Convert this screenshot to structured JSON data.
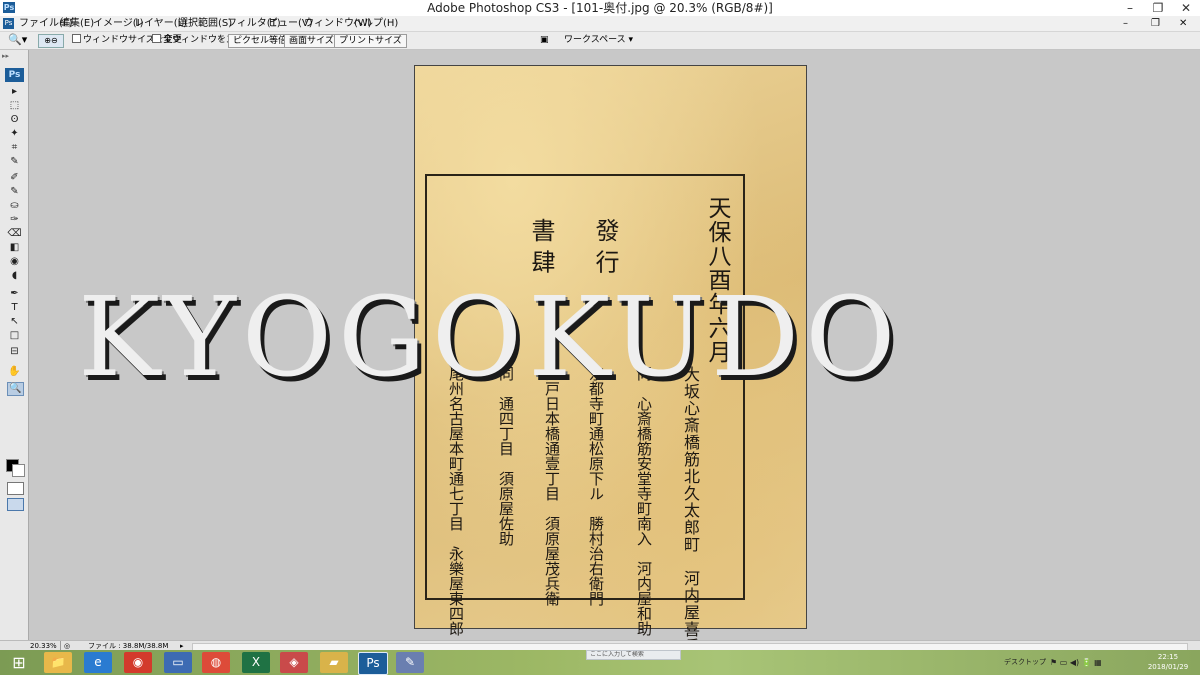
{
  "window": {
    "title": "Adobe Photoshop CS3 - [101-奥付.jpg @ 20.3% (RGB/8#)]",
    "app_icon_label": "Ps",
    "minimize": "–",
    "restore": "❐",
    "close": "✕"
  },
  "menu": {
    "items": [
      "ファイル(F)",
      "編集(E)",
      "イメージ(I)",
      "レイヤー(L)",
      "選択範囲(S)",
      "フィルタ(T)",
      "ビュー(V)",
      "ウィンドウ(W)",
      "ヘルプ(H)"
    ],
    "doc_minimize": "–",
    "doc_restore": "❐",
    "doc_close": "✕"
  },
  "options_bar": {
    "tool_icon": "zoom-icon",
    "resize_windows_label": "ウィンドウサイズを変更",
    "zoom_all_windows_label": "全ウィンドウをズーム",
    "actual_pixels_label": "ピクセル等倍",
    "fit_screen_label": "画面サイズ",
    "print_size_label": "プリントサイズ",
    "workspace_label": "ワークスペース ▾"
  },
  "tool_palette": {
    "badge": "Ps",
    "tools": [
      "▸",
      "⬚",
      "ʘ",
      "✦",
      "⌗",
      "✎",
      "✐",
      "✎",
      "⛀",
      "✑",
      "⌫",
      "◧",
      "◉",
      "◖",
      "✒",
      "T",
      "↖",
      "□",
      "⊟",
      "✋",
      "🔍"
    ],
    "foreground_color": "#000000",
    "background_color": "#ffffff"
  },
  "document": {
    "image_description_text": {
      "col_date": "天保八酉年六月",
      "col_publisher_heading_1": "發 行",
      "col_publisher_heading_2": "書 肆",
      "col_1": "大坂心斎橋筋北久太郎町　河内屋喜兵衛",
      "col_2": "同　心斎橋筋安堂寺町南入　河内屋和助",
      "col_3": "京都寺町通松原下ル　勝村治右衛門",
      "col_4": "江戸日本橋通壹丁目　須原屋茂兵衛",
      "col_5": "同　通四丁目　須原屋佐助",
      "col_6": "尾州名古屋本町通七丁目　永樂屋東四郎"
    },
    "watermark": "KYOGOKUDO"
  },
  "status_bar": {
    "zoom": "20.33%",
    "file_info": "ファイル : 38.8M/38.8M",
    "arrow": "▸"
  },
  "taskbar": {
    "start_icon": "⊞",
    "apps": [
      {
        "name": "file-explorer",
        "glyph": "📁",
        "color": "#e8b84a"
      },
      {
        "name": "internet-explorer",
        "glyph": "e",
        "color": "#2a7bd1"
      },
      {
        "name": "app-red",
        "glyph": "◉",
        "color": "#d33a2c"
      },
      {
        "name": "app-monitor",
        "glyph": "▭",
        "color": "#3d6bb3"
      },
      {
        "name": "chrome",
        "glyph": "◍",
        "color": "#dd4b39"
      },
      {
        "name": "excel",
        "glyph": "X",
        "color": "#1f7244"
      },
      {
        "name": "app-photos",
        "glyph": "◈",
        "color": "#c94a4a"
      },
      {
        "name": "app-folder",
        "glyph": "▰",
        "color": "#d9b34a"
      },
      {
        "name": "photoshop",
        "glyph": "Ps",
        "color": "#1c5d99"
      },
      {
        "name": "app-paint",
        "glyph": "✎",
        "color": "#6a7fb0"
      }
    ],
    "hint": "ここに入力して検索",
    "desktop_label": "デスクトップ",
    "tray_icons": "⚑ ▭ ◀) 🔋 ▦",
    "clock_time": "22:15",
    "clock_date": "2018/01/29"
  }
}
